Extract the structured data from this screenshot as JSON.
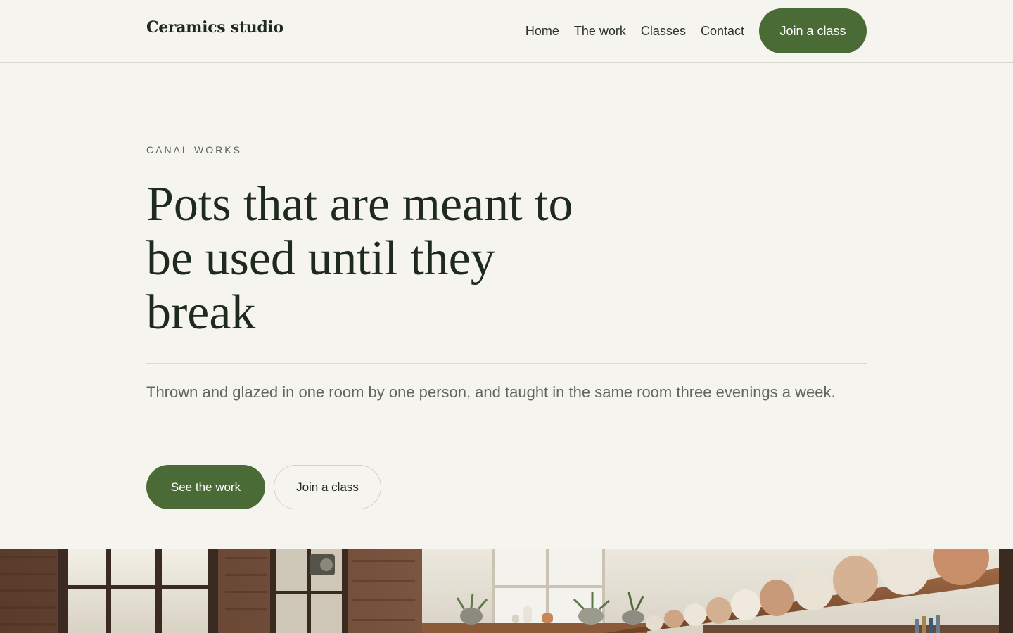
{
  "header": {
    "brand": "Ceramics studio",
    "nav": [
      "Home",
      "The work",
      "Classes",
      "Contact"
    ],
    "cta_label": "Join a class"
  },
  "hero": {
    "eyebrow": "CANAL WORKS",
    "headline": "Pots that are meant to be used until they break",
    "lede": "Thrown and glazed in one room by one person, and taught in the same room three evenings a week.",
    "primary_label": "See the work",
    "secondary_label": "Join a class"
  },
  "colors": {
    "background": "#f5f4ee",
    "accent": "#4a6b36",
    "text": "#1e2a1c",
    "muted": "#5f695b"
  }
}
